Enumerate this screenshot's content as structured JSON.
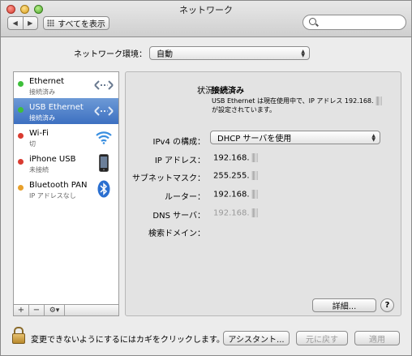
{
  "window": {
    "title": "ネットワーク"
  },
  "toolbar": {
    "back_glyph": "◀",
    "forward_glyph": "▶",
    "show_all_label": "すべてを表示",
    "search_placeholder": ""
  },
  "location": {
    "label": "ネットワーク環境：",
    "value": "自動"
  },
  "services": [
    {
      "name": "Ethernet",
      "status": "接続済み",
      "status_color": "#3dbf3a",
      "icon": "ethernet-arrows-icon",
      "selected": false
    },
    {
      "name": "USB Ethernet",
      "status": "接続済み",
      "status_color": "#3dbf3a",
      "icon": "ethernet-arrows-icon",
      "selected": true
    },
    {
      "name": "Wi-Fi",
      "status": "切",
      "status_color": "#d93b30",
      "icon": "wifi-icon",
      "selected": false
    },
    {
      "name": "iPhone USB",
      "status": "未接続",
      "status_color": "#d93b30",
      "icon": "iphone-icon",
      "selected": false
    },
    {
      "name": "Bluetooth PAN",
      "status": "IP アドレスなし",
      "status_color": "#e8a02a",
      "icon": "bluetooth-icon",
      "selected": false
    }
  ],
  "sidebar_tools": {
    "add": "+",
    "remove": "−",
    "gear": "⚙▾"
  },
  "detail": {
    "status_label": "状況：",
    "status_value": "接続済み",
    "status_desc": "USB Ethernet は現在使用中で、IP アドレス 192.168.",
    "status_desc2": "が設定されています。",
    "ipv4_label": "IPv4 の構成：",
    "ipv4_value": "DHCP サーバを使用",
    "ip_label": "IP アドレス：",
    "ip_value": "192.168.",
    "subnet_label": "サブネットマスク：",
    "subnet_value": "255.255.",
    "router_label": "ルーター：",
    "router_value": "192.168.",
    "dns_label": "DNS サーバ：",
    "dns_value": "192.168.",
    "search_domain_label": "検索ドメイン："
  },
  "buttons": {
    "advanced": "詳細...",
    "help": "?",
    "assistant": "アシスタント...",
    "revert": "元に戻す",
    "apply": "適用"
  },
  "lock": {
    "text": "変更できないようにするにはカギをクリックします。"
  }
}
